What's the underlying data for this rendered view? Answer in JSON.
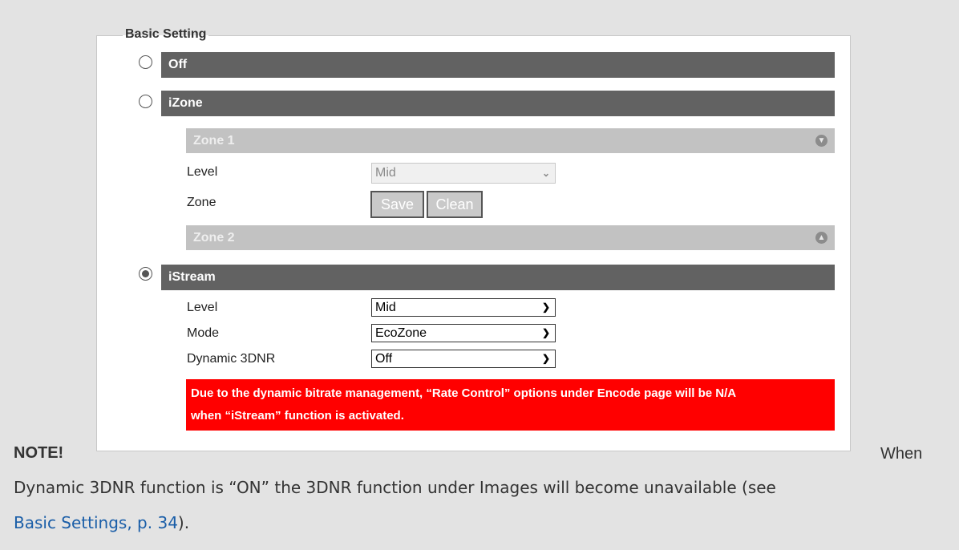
{
  "basic_setting": {
    "legend": "Basic Setting",
    "options": [
      {
        "label": "Off",
        "selected": false
      },
      {
        "label": "iZone",
        "selected": false
      },
      {
        "label": "iStream",
        "selected": true
      }
    ]
  },
  "izone": {
    "zone1": {
      "label": "Zone 1",
      "icon": "chevron-down-circle-icon"
    },
    "level_label": "Level",
    "level_value": "Mid",
    "zone_label": "Zone",
    "save_label": "Save",
    "clean_label": "Clean",
    "zone2": {
      "label": "Zone 2",
      "icon": "chevron-up-circle-icon"
    }
  },
  "istream": {
    "level_label": "Level",
    "level_value": "Mid",
    "mode_label": "Mode",
    "mode_value": "EcoZone",
    "dnr_label": "Dynamic 3DNR",
    "dnr_value": "Off",
    "warning_line1": "Due to the dynamic bitrate management, “Rate Control” options under Encode page will be N/A",
    "warning_line2": "when “iStream” function is activated."
  },
  "note": {
    "label": "NOTE!",
    "when": "When",
    "line1": "Dynamic 3DNR function is “ON” the 3DNR function under Images will become unavailable (see",
    "link": "Basic Settings, p. 34",
    "line2_end": ")."
  },
  "colors": {
    "bar": "#626262",
    "zone_bar": "#c2c2c2",
    "warning": "#ff0000",
    "link": "#1a5ea8"
  }
}
